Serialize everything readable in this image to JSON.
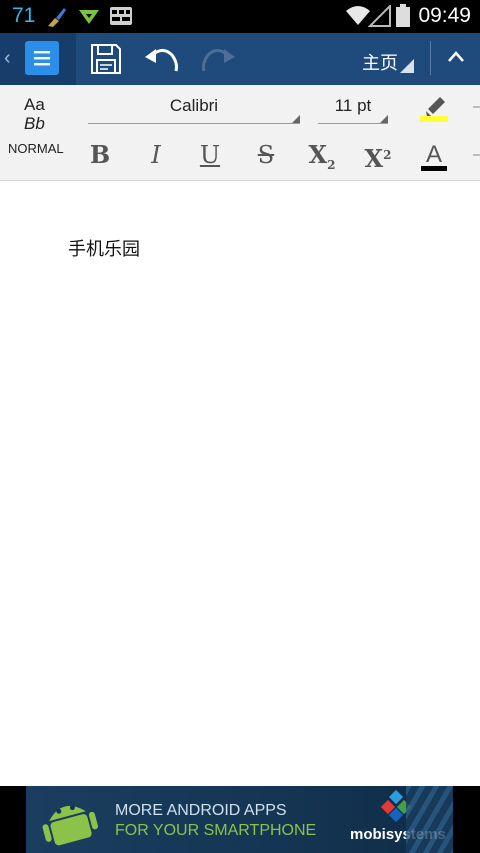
{
  "status_bar": {
    "notification_count": "71",
    "time": "09:49",
    "icons": [
      "broom-icon",
      "download-icon",
      "keyboard-icon",
      "wifi-icon",
      "signal-icon",
      "battery-icon"
    ]
  },
  "action_bar": {
    "home_label": "主页",
    "icons": [
      "back-chevron-icon",
      "document-icon",
      "save-icon",
      "undo-icon",
      "redo-icon",
      "collapse-icon"
    ]
  },
  "toolbar": {
    "style_sample_line1": "Aa",
    "style_sample_line2": "Bb",
    "style_name": "NORMAL",
    "font_name": "Calibri",
    "font_size": "11 pt",
    "highlight_color": "#ffff33",
    "font_color": "#000000",
    "bold": "B",
    "italic": "I",
    "underline": "U",
    "strike": "S",
    "subscript_base": "X",
    "subscript_mark": "2",
    "superscript_base": "X",
    "superscript_mark": "2",
    "font_color_letter": "A"
  },
  "document": {
    "paragraph": "手机乐园"
  },
  "ad": {
    "line1": "MORE ANDROID APPS",
    "line2": "FOR YOUR SMARTPHONE",
    "brand": "mobisystems"
  }
}
